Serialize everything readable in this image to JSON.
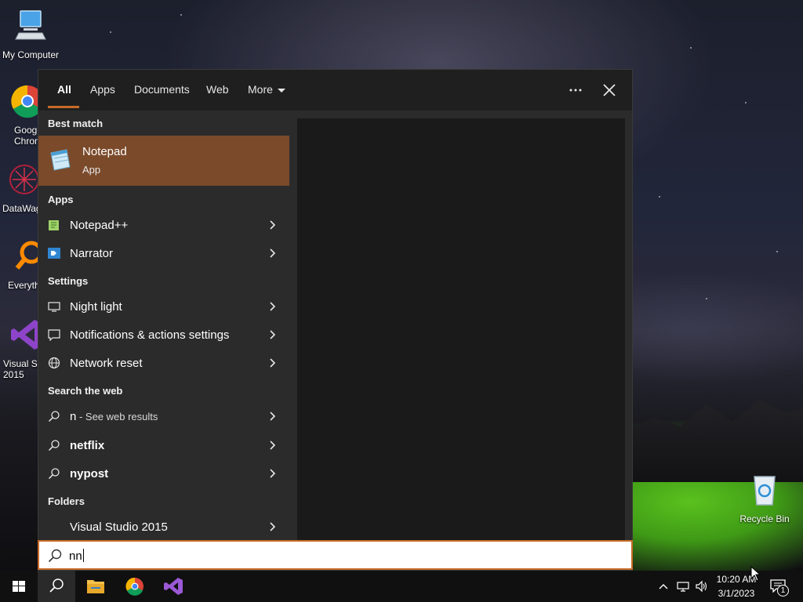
{
  "desktop": {
    "icons": [
      {
        "label": "My Computer"
      },
      {
        "label": "Goog\nChron"
      },
      {
        "label": "DataWag"
      },
      {
        "label": "Everyth"
      },
      {
        "label": "Visual St\n2015"
      },
      {
        "label": "Recycle Bin"
      }
    ]
  },
  "search_panel": {
    "tabs": [
      {
        "label": "All"
      },
      {
        "label": "Apps"
      },
      {
        "label": "Documents"
      },
      {
        "label": "Web"
      },
      {
        "label": "More"
      }
    ],
    "more_options_icon": "ellipsis-icon",
    "close_icon": "close-icon",
    "best_match": {
      "heading": "Best match",
      "title": "Notepad",
      "subtitle": "App"
    },
    "apps": {
      "heading": "Apps",
      "items": [
        {
          "label": "Notepad++"
        },
        {
          "label": "Narrator"
        }
      ]
    },
    "settings": {
      "heading": "Settings",
      "items": [
        {
          "label": "Night light"
        },
        {
          "label": "Notifications & actions settings"
        },
        {
          "label": "Network reset"
        }
      ]
    },
    "web": {
      "heading": "Search the web",
      "items": [
        {
          "label": "n",
          "suffix": " - See web results"
        },
        {
          "label": "netflix"
        },
        {
          "label": "nypost"
        }
      ]
    },
    "folders": {
      "heading": "Folders",
      "items": [
        {
          "label": "Visual Studio 2015"
        }
      ]
    },
    "search_value": "nn"
  },
  "taskbar": {
    "time": "10:20 AM",
    "date": "3/1/2023",
    "notification_count": "1"
  },
  "colors": {
    "accent": "#c96b28",
    "best_match_bg": "#7a4a2a",
    "panel_bg": "#2b2b2b",
    "taskbar_bg": "#101010"
  }
}
